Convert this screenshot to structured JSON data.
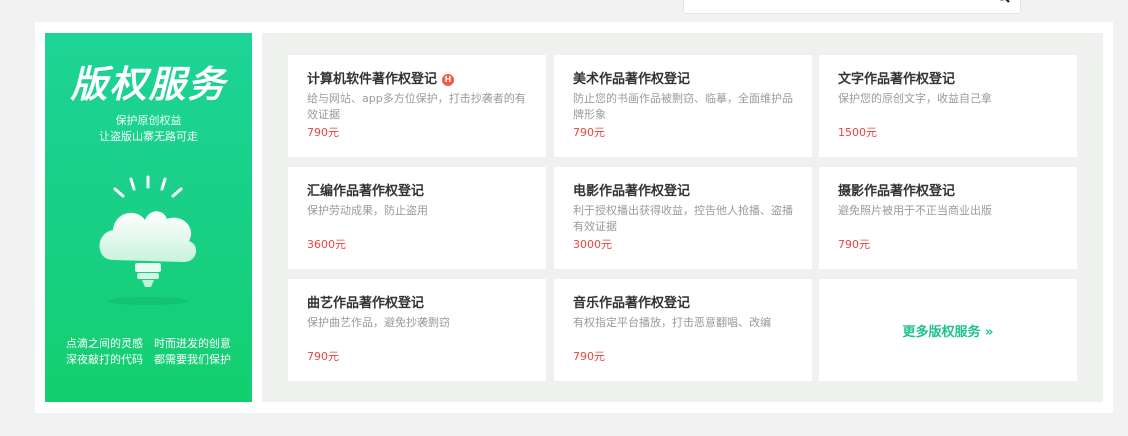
{
  "promo": {
    "title": "版权服务",
    "subtitle_1": "保护原创权益",
    "subtitle_2": "让盗版山寨无路可走",
    "footer_1": "点滴之间的灵感　时而迸发的创意",
    "footer_2": "深夜敲打的代码　都需要我们保护",
    "accent": "#18cf84"
  },
  "badge": "H",
  "services": [
    {
      "title": "计算机软件著作权登记",
      "desc": "给与网站、app多方位保护，打击抄袭者的有效证据",
      "price": "790元",
      "hot": true
    },
    {
      "title": "美术作品著作权登记",
      "desc": "防止您的书画作品被剽窃、临摹，全面维护品牌形象",
      "price": "790元"
    },
    {
      "title": "文字作品著作权登记",
      "desc": "保护您的原创文字，收益自己拿",
      "price": "1500元"
    },
    {
      "title": "汇编作品著作权登记",
      "desc": "保护劳动成果，防止盗用",
      "price": "3600元"
    },
    {
      "title": "电影作品著作权登记",
      "desc": "利于授权播出获得收益，控告他人抢播、盗播有效证据",
      "price": "3000元"
    },
    {
      "title": "摄影作品著作权登记",
      "desc": "避免照片被用于不正当商业出版",
      "price": "790元"
    },
    {
      "title": "曲艺作品著作权登记",
      "desc": "保护曲艺作品，避免抄袭剽窃",
      "price": "790元"
    },
    {
      "title": "音乐作品著作权登记",
      "desc": "有权指定平台播放，打击恶意翻唱、改编",
      "price": "790元"
    }
  ],
  "more": {
    "label": "更多版权服务 »",
    "color": "#1ec48a"
  },
  "price_color": "#e8453c"
}
